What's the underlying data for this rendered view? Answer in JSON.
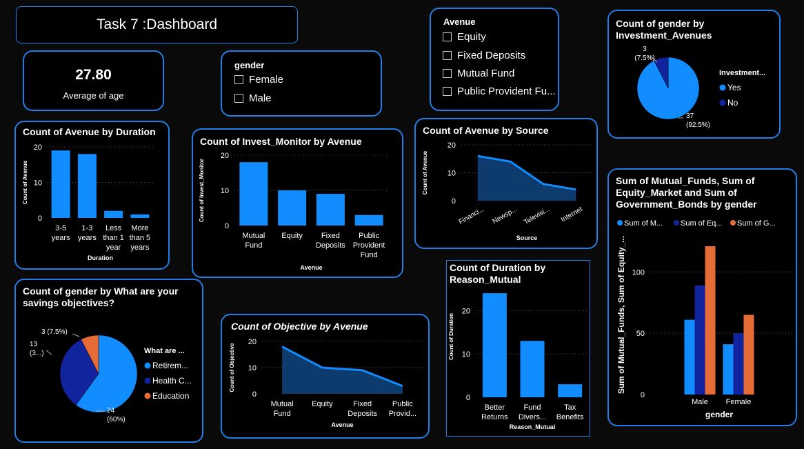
{
  "header": {
    "title": "Task 7 :Dashboard"
  },
  "kpi": {
    "value": "27.80",
    "label": "Average of age"
  },
  "gender_slicer": {
    "title": "gender",
    "options": [
      "Female",
      "Male"
    ]
  },
  "avenue_slicer": {
    "title": "Avenue",
    "options": [
      "Equity",
      "Fixed Deposits",
      "Mutual Fund",
      "Public Provident Fu..."
    ]
  },
  "colors": {
    "primary": "#118dff",
    "dark_blue": "#12239e",
    "orange": "#e66c37",
    "border": "#1f7fe6"
  },
  "chart_data": [
    {
      "id": "duration",
      "type": "bar",
      "title": "Count of Avenue by Duration",
      "xlabel": "Duration",
      "ylabel": "Count of Avenue",
      "categories": [
        [
          "3-5",
          "years"
        ],
        [
          "1-3",
          "years"
        ],
        [
          "Less",
          "than 1",
          "year"
        ],
        [
          "More",
          "than 5",
          "years"
        ]
      ],
      "values": [
        19,
        18,
        2,
        1
      ],
      "yticks": [
        "0",
        "10",
        "20"
      ],
      "ylim": [
        0,
        20
      ],
      "grid": true
    },
    {
      "id": "monitor",
      "type": "bar",
      "title": "Count of Invest_Monitor by Avenue",
      "xlabel": "Avenue",
      "ylabel": "Count of Invest_Monitor",
      "categories": [
        [
          "Mutual",
          "Fund"
        ],
        [
          "Equity"
        ],
        [
          "Fixed",
          "Deposits"
        ],
        [
          "Public",
          "Provident",
          "Fund"
        ]
      ],
      "values": [
        18,
        10,
        9,
        3
      ],
      "yticks": [
        "0",
        "10",
        "20"
      ],
      "ylim": [
        0,
        20
      ],
      "grid": true
    },
    {
      "id": "source",
      "type": "area",
      "title": "Count of Avenue by Source",
      "xlabel": "Source",
      "ylabel": "Count of Avenue",
      "categories": [
        "Financi...",
        "Newsp...",
        "Televisi...",
        "Internet"
      ],
      "values": [
        16,
        14,
        6,
        4
      ],
      "yticks": [
        "0",
        "10",
        "20"
      ],
      "ylim": [
        0,
        20
      ],
      "grid": true
    },
    {
      "id": "objective",
      "type": "area",
      "title": "Count of Objective by Avenue",
      "xlabel": "Avenue",
      "ylabel": "Count of Objective",
      "categories": [
        [
          "Mutual",
          "Fund"
        ],
        [
          "Equity"
        ],
        [
          "Fixed",
          "Deposits"
        ],
        [
          "Public",
          "Provid..."
        ]
      ],
      "values": [
        18,
        10,
        9,
        3
      ],
      "yticks": [
        "0",
        "10",
        "20"
      ],
      "ylim": [
        0,
        20
      ],
      "grid": true
    },
    {
      "id": "reason",
      "type": "bar",
      "title": "Count of Duration by Reason_Mutual",
      "title_lines": [
        "Count of Duration by",
        "Reason_Mutual"
      ],
      "xlabel": "Reason_Mutual",
      "ylabel": "Count of Duration",
      "categories": [
        [
          "Better",
          "Returns"
        ],
        [
          "Fund",
          "Divers..."
        ],
        [
          "Tax",
          "Benefits"
        ]
      ],
      "values": [
        24,
        13,
        3
      ],
      "yticks": [
        "0",
        "10",
        "20"
      ],
      "ylim": [
        0,
        28
      ],
      "grid": true
    },
    {
      "id": "invest_pie",
      "type": "pie",
      "title": "Count of gender by Investment_Avenues",
      "title_lines": [
        "Count of gender by",
        "Investment_Avenues"
      ],
      "legend_title": "Investment...",
      "categories": [
        "Yes",
        "No"
      ],
      "values": [
        37,
        3
      ],
      "data_labels": [
        [
          "37",
          "(92.5%)"
        ],
        [
          "3",
          "(7.5%)"
        ]
      ]
    },
    {
      "id": "savings_pie",
      "type": "pie",
      "title": "Count of gender by What are your savings objectives?",
      "title_lines": [
        "Count of gender by What are your",
        "savings objectives?"
      ],
      "legend_title": "What are ...",
      "categories": [
        "Retirem...",
        "Health C...",
        "Education"
      ],
      "values": [
        24,
        13,
        3
      ],
      "data_labels": [
        [
          "24",
          "(60%)"
        ],
        [
          "13",
          "(3...)"
        ],
        [
          "3 (7.5%)"
        ]
      ]
    },
    {
      "id": "grouped",
      "type": "bar",
      "title": "Sum of Mutual_Funds, Sum of Equity_Market and Sum of Government_Bonds by gender",
      "title_lines": [
        "Sum of Mutual_Funds, Sum of",
        "Equity_Market and Sum of",
        "Government_Bonds by gender"
      ],
      "xlabel": "gender",
      "ylabel": "Sum of Mutual_Funds, Sum of Equity_...",
      "categories": [
        "Male",
        "Female"
      ],
      "series": [
        {
          "name": "Sum of M...",
          "values": [
            61,
            89,
            121
          ]
        },
        {
          "name": "Sum of Eq...",
          "values": [
            41,
            50,
            65
          ]
        },
        {
          "name": "Sum of G...",
          "values": []
        }
      ],
      "grouped_values": {
        "Male": [
          61,
          89,
          121
        ],
        "Female": [
          41,
          50,
          65
        ]
      },
      "yticks": [
        "0",
        "50",
        "100"
      ],
      "ylim": [
        0,
        130
      ],
      "grid": true
    }
  ]
}
